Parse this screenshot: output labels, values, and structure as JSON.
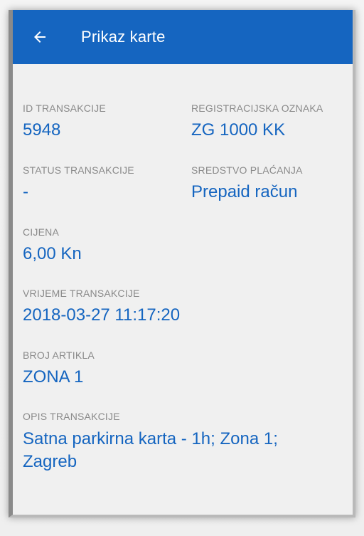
{
  "header": {
    "title": "Prikaz karte",
    "back_icon": "arrow-left-icon"
  },
  "colors": {
    "accent": "#1565c0",
    "label": "#8a8a8a",
    "background": "#f0f0f0"
  },
  "fields": {
    "id_transakcije": {
      "label": "ID TRANSAKCIJE",
      "value": "5948"
    },
    "registracijska_oznaka": {
      "label": "REGISTRACIJSKA OZNAKA",
      "value": "ZG 1000 KK"
    },
    "status_transakcije": {
      "label": "STATUS TRANSAKCIJE",
      "value": "-"
    },
    "sredstvo_placanja": {
      "label": "SREDSTVO PLAĆANJA",
      "value": "Prepaid račun"
    },
    "cijena": {
      "label": "CIJENA",
      "value": "6,00 Kn"
    },
    "vrijeme_transakcije": {
      "label": "VRIJEME TRANSAKCIJE",
      "value": "2018-03-27 11:17:20"
    },
    "broj_artikla": {
      "label": "BROJ ARTIKLA",
      "value": "ZONA 1"
    },
    "opis_transakcije": {
      "label": "OPIS TRANSAKCIJE",
      "value": "Satna parkirna karta - 1h; Zona 1; Zagreb"
    }
  }
}
